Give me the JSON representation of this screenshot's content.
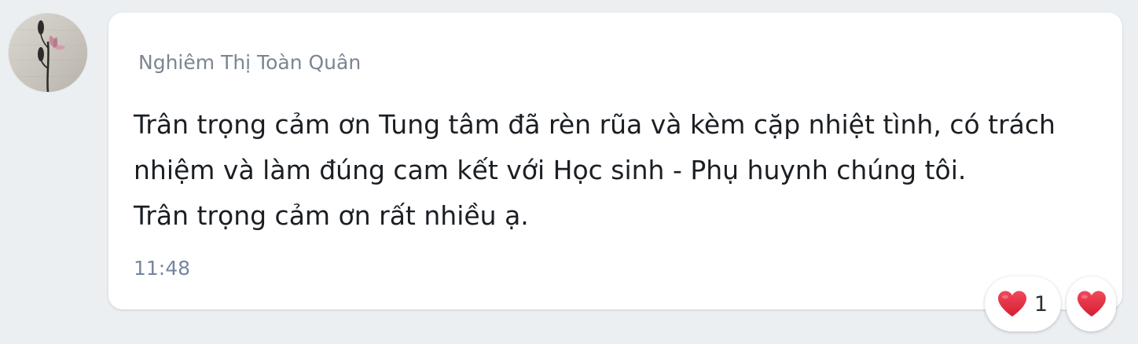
{
  "message": {
    "sender_name": "Nghiêm Thị Toàn Quân",
    "lines": [
      "Trân trọng cảm ơn Tung tâm đã rèn rũa và kèm cặp nhiệt tình, có trách",
      "nhiệm và làm đúng cam kết với Học sinh - Phụ huynh chúng tôi.",
      "Trân trọng cảm ơn rất nhiều ạ."
    ],
    "time": "11:48"
  },
  "avatar": {
    "icon": "lotus-flower-avatar"
  },
  "reactions": {
    "heart_reaction": {
      "icon": "heart-icon",
      "count": "1"
    },
    "add_reaction": {
      "icon": "heart-icon"
    }
  },
  "colors": {
    "background": "#eceff2",
    "bubble": "#ffffff",
    "sender": "#7b8594",
    "text": "#1b1f24",
    "time": "#7686a0",
    "heart": "#e02a3b"
  }
}
